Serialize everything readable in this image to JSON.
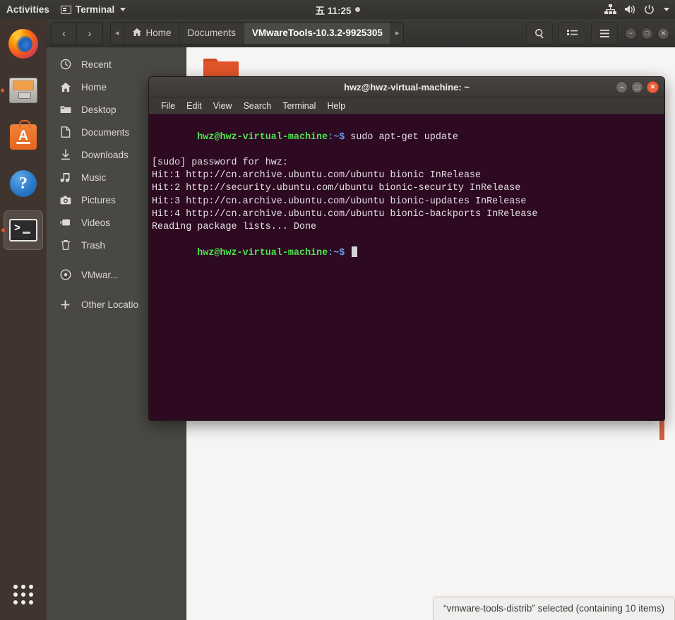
{
  "topbar": {
    "activities": "Activities",
    "app_menu": "Terminal",
    "app_icon": "terminal-icon",
    "clock": "五 11:25",
    "clock_dot": "notification-dot",
    "icons": [
      "network-icon",
      "volume-icon",
      "power-icon",
      "chevron-down-icon"
    ]
  },
  "dock": {
    "items": [
      {
        "name": "firefox",
        "running": false
      },
      {
        "name": "files",
        "running": true
      },
      {
        "name": "ubuntu-software",
        "running": false
      },
      {
        "name": "help",
        "running": false
      },
      {
        "name": "terminal",
        "running": true,
        "active": true
      }
    ],
    "show_apps": "show-applications-grid"
  },
  "files_window": {
    "nav": {
      "back": "‹",
      "forward": "›"
    },
    "breadcrumbs": [
      {
        "label": "◂",
        "kind": "overflow"
      },
      {
        "label": "Home",
        "icon": "home-icon",
        "current": false
      },
      {
        "label": "Documents",
        "current": false
      },
      {
        "label": "VMwareTools-10.3.2-9925305",
        "current": true
      },
      {
        "label": "▸",
        "kind": "overflow"
      }
    ],
    "actions": [
      {
        "name": "search-icon",
        "glyph": "⚲"
      },
      {
        "name": "view-list-icon",
        "glyph": "≡"
      },
      {
        "name": "hamburger-menu-icon",
        "glyph": "☰"
      }
    ],
    "window_buttons": [
      {
        "name": "minimize-button",
        "glyph": "−"
      },
      {
        "name": "maximize-button",
        "glyph": "□"
      },
      {
        "name": "close-button",
        "glyph": "✕"
      }
    ],
    "sidebar": [
      {
        "label": "Recent",
        "icon": "clock-icon"
      },
      {
        "label": "Home",
        "icon": "home-icon"
      },
      {
        "label": "Desktop",
        "icon": "desktop-folder-icon"
      },
      {
        "label": "Documents",
        "icon": "document-icon"
      },
      {
        "label": "Downloads",
        "icon": "download-icon"
      },
      {
        "label": "Music",
        "icon": "music-note-icon"
      },
      {
        "label": "Pictures",
        "icon": "camera-icon"
      },
      {
        "label": "Videos",
        "icon": "video-icon"
      },
      {
        "label": "Trash",
        "icon": "trash-icon"
      },
      {
        "label": "VMwar...",
        "icon": "disc-icon"
      },
      {
        "label": "Other Locatio",
        "icon": "plus-icon"
      }
    ],
    "status": "“vmware-tools-distrib” selected  (containing 10 items)"
  },
  "terminal": {
    "title": "hwz@hwz-virtual-machine: ~",
    "menu": [
      "File",
      "Edit",
      "View",
      "Search",
      "Terminal",
      "Help"
    ],
    "window_buttons": [
      {
        "name": "minimize-button",
        "glyph": "−"
      },
      {
        "name": "maximize-button",
        "glyph": "□"
      },
      {
        "name": "close-button",
        "glyph": "✕"
      }
    ],
    "lines": [
      {
        "type": "prompt",
        "user": "hwz@hwz-virtual-machine",
        "path": ":~$ ",
        "cmd": "sudo apt-get update"
      },
      {
        "type": "out",
        "text": "[sudo] password for hwz:"
      },
      {
        "type": "out",
        "text": "Hit:1 http://cn.archive.ubuntu.com/ubuntu bionic InRelease"
      },
      {
        "type": "out",
        "text": "Hit:2 http://security.ubuntu.com/ubuntu bionic-security InRelease"
      },
      {
        "type": "out",
        "text": "Hit:3 http://cn.archive.ubuntu.com/ubuntu bionic-updates InRelease"
      },
      {
        "type": "out",
        "text": "Hit:4 http://cn.archive.ubuntu.com/ubuntu bionic-backports InRelease"
      },
      {
        "type": "out",
        "text": "Reading package lists... Done"
      },
      {
        "type": "prompt",
        "user": "hwz@hwz-virtual-machine",
        "path": ":~$ ",
        "cmd": ""
      }
    ]
  },
  "colors": {
    "terminal_bg": "#2d0922",
    "prompt_green": "#4ee24e",
    "prompt_blue": "#6a9fe8",
    "ubuntu_orange": "#e95420",
    "dock_bg": "#40342f",
    "sidebar_bg": "#494843"
  }
}
